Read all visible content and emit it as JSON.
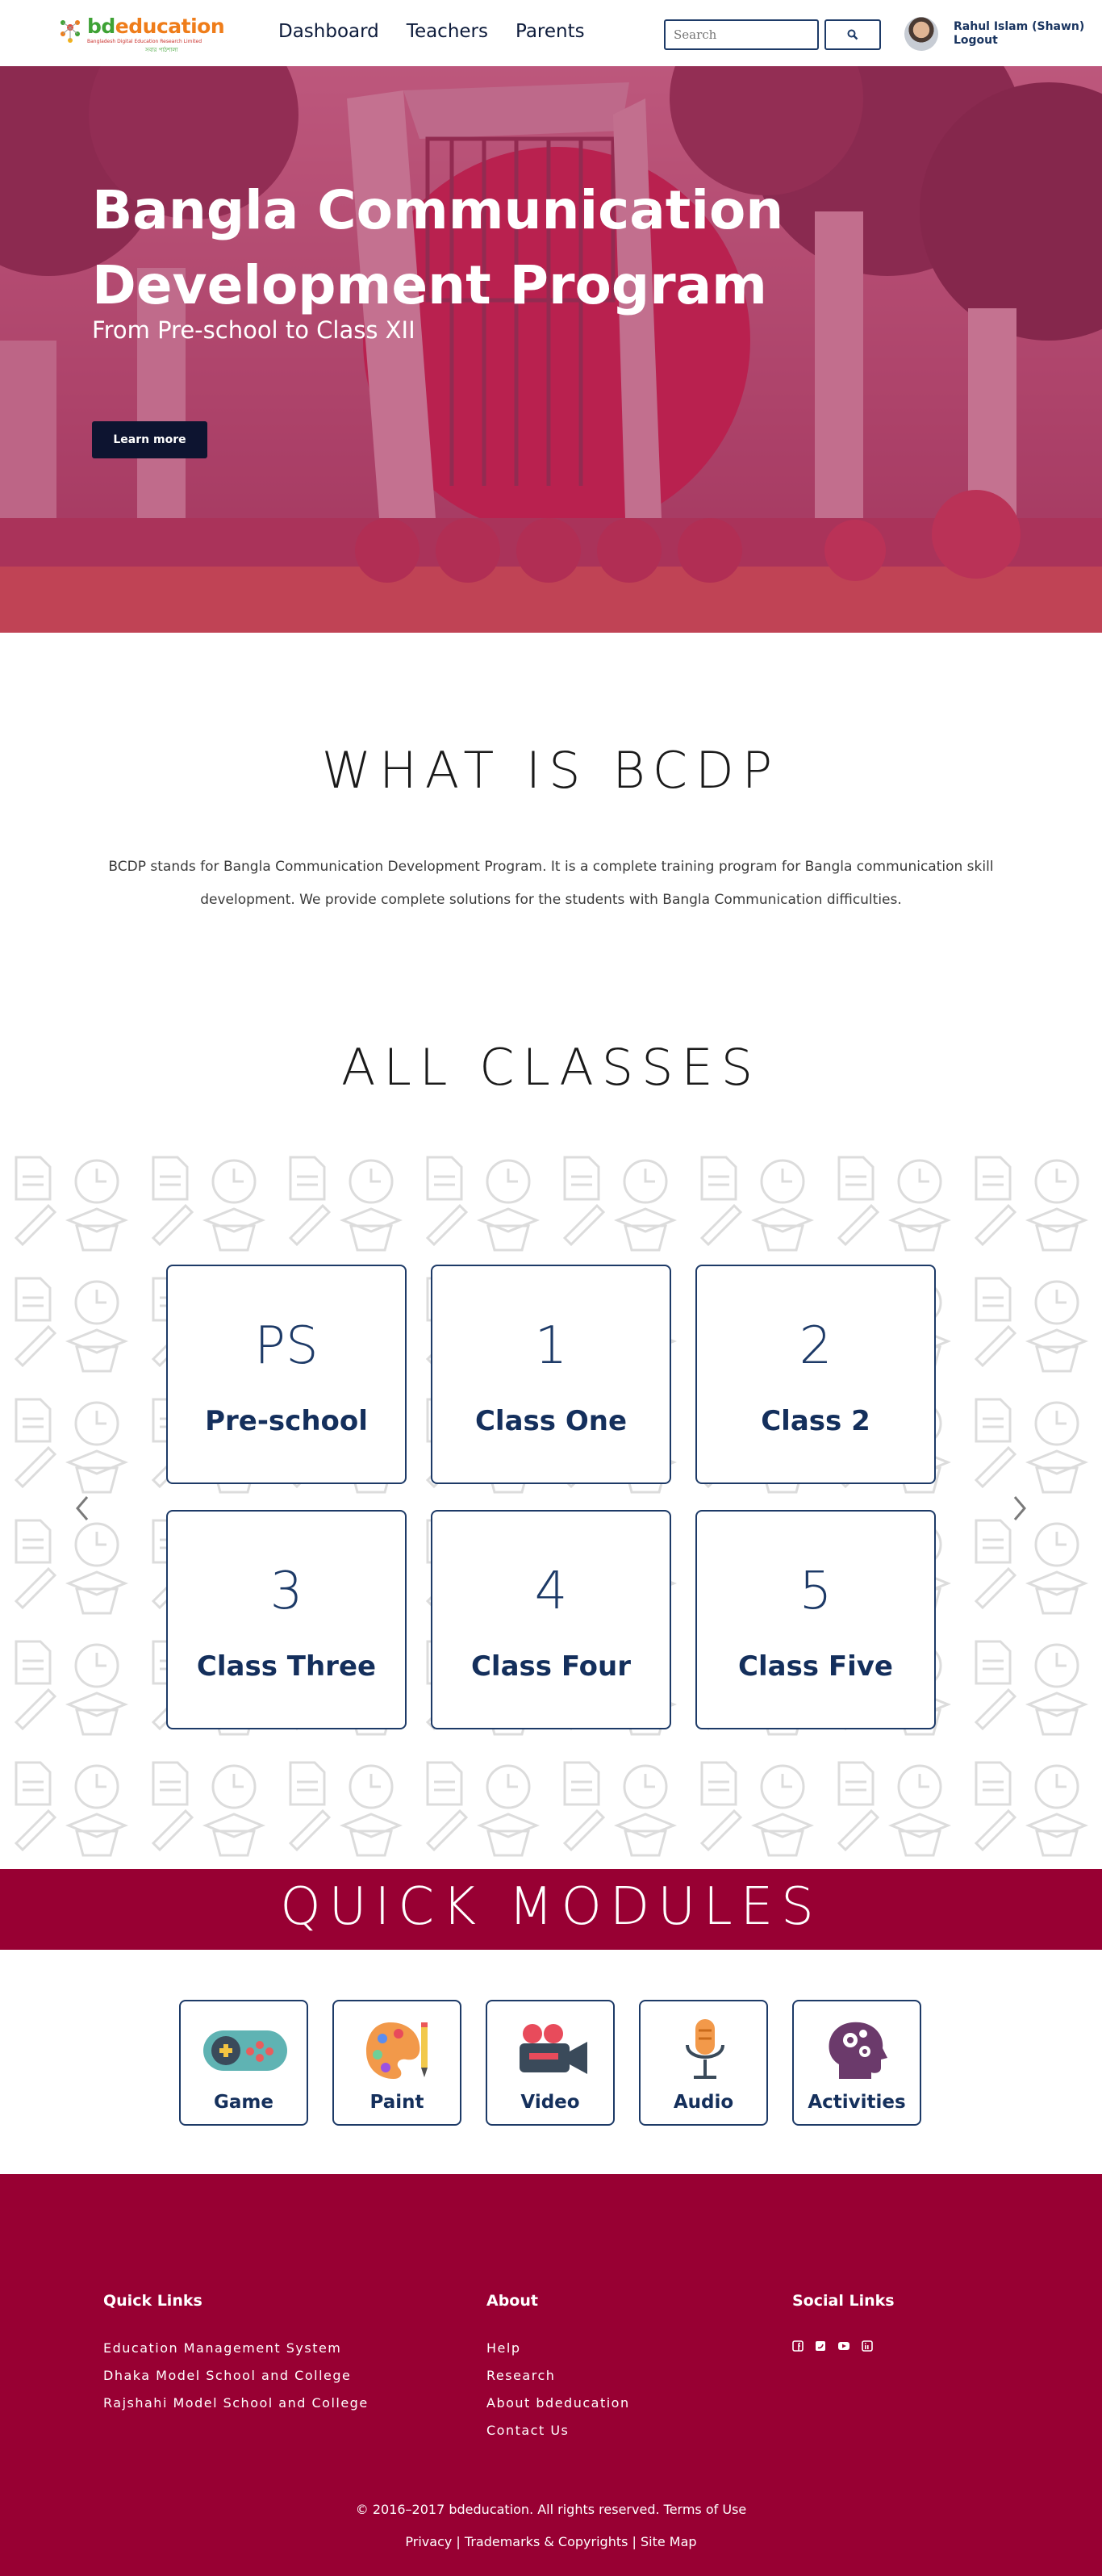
{
  "header": {
    "logo": {
      "text_bd": "bd",
      "text_rest": "education",
      "tagline": "Bangladesh Digital Education Research Limited",
      "tagline2": "সবার পাঠশালা"
    },
    "nav": [
      "Dashboard",
      "Teachers",
      "Parents"
    ],
    "search_placeholder": "Search",
    "search_icon": "search-icon",
    "user": {
      "name": "Rahul Islam (Shawn)",
      "logout": "Logout"
    }
  },
  "hero": {
    "title": "Bangla Communication Development Program",
    "subtitle": "From Pre-school to Class XII",
    "button": "Learn more"
  },
  "what": {
    "title": "WHAT IS BCDP",
    "text": "BCDP stands for Bangla Communication Development Program. It is a complete training program for Bangla communication skill development. We provide complete solutions for the students with Bangla Communication difficulties."
  },
  "classes": {
    "title": "ALL CLASSES",
    "items": [
      {
        "num": "PS",
        "name": "Pre-school"
      },
      {
        "num": "1",
        "name": "Class One"
      },
      {
        "num": "2",
        "name": "Class 2"
      },
      {
        "num": "3",
        "name": "Class Three"
      },
      {
        "num": "4",
        "name": "Class Four"
      },
      {
        "num": "5",
        "name": "Class Five"
      }
    ],
    "prev_icon": "chevron-left-icon",
    "next_icon": "chevron-right-icon"
  },
  "modules": {
    "title": "QUICK MODULES",
    "items": [
      {
        "label": "Game",
        "icon": "gamepad-icon"
      },
      {
        "label": "Paint",
        "icon": "palette-icon"
      },
      {
        "label": "Video",
        "icon": "video-camera-icon"
      },
      {
        "label": "Audio",
        "icon": "microphone-icon"
      },
      {
        "label": "Activities",
        "icon": "brain-gears-icon"
      }
    ]
  },
  "footer": {
    "quick_links": {
      "heading": "Quick Links",
      "links": [
        "Education Management System",
        "Dhaka Model School and College",
        "Rajshahi Model School and College"
      ]
    },
    "about": {
      "heading": "About",
      "links": [
        "Help",
        "Research",
        "About bdeducation",
        "Contact Us"
      ]
    },
    "social": {
      "heading": "Social Links",
      "icons": [
        "facebook-icon",
        "twitter-icon",
        "youtube-icon",
        "linkedin-icon"
      ]
    },
    "copyright": "© 2016–2017 bdeducation. All rights reserved. Terms of Use",
    "legal": "Privacy | Trademarks & Copyrights | Site Map"
  },
  "colors": {
    "navy": "#1d3a67",
    "maroon": "#980033",
    "hero_tint": "#b22e5c"
  }
}
